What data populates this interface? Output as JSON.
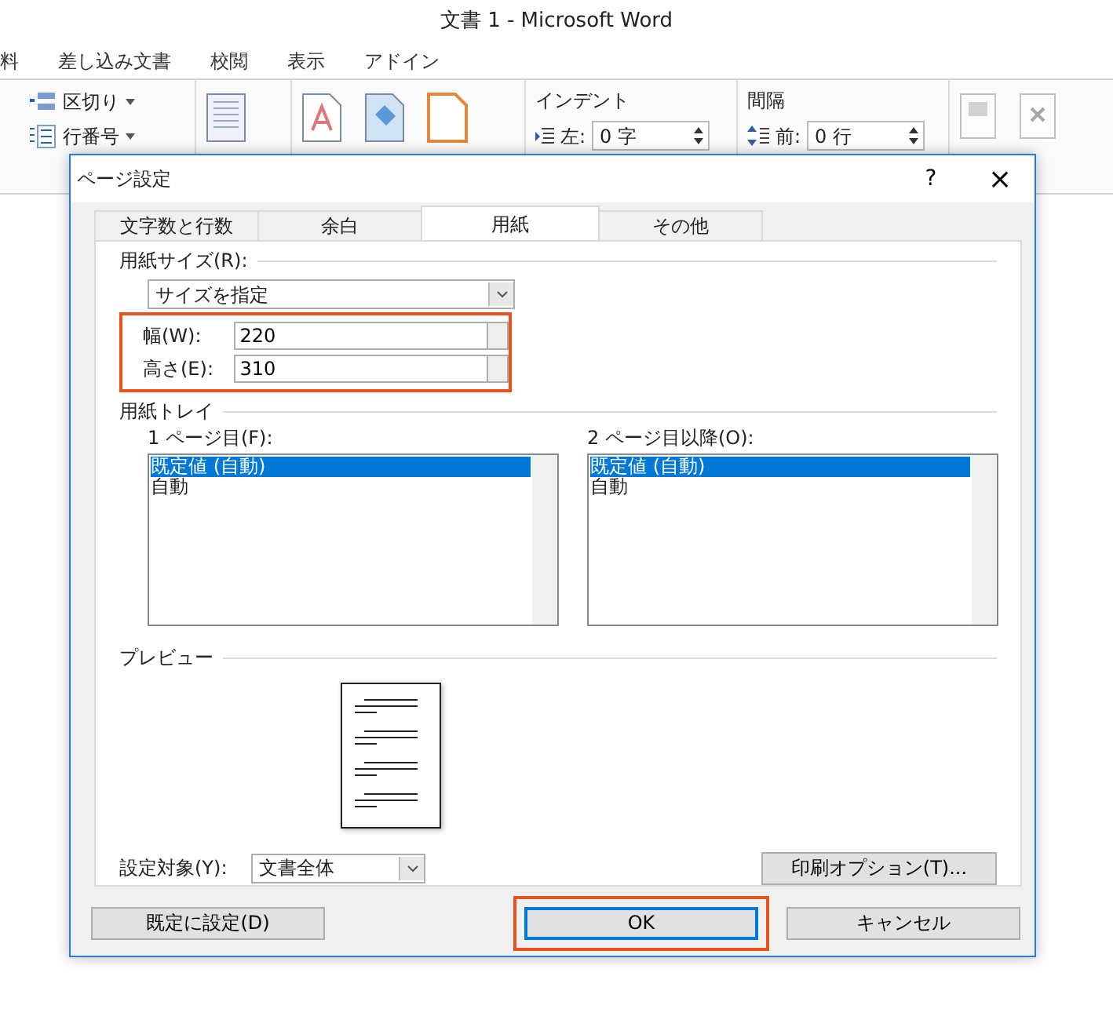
{
  "window": {
    "title": "文書 1 - Microsoft Word"
  },
  "ribbon_tabs": [
    {
      "label": "料"
    },
    {
      "label": "差し込み文書"
    },
    {
      "label": "校閲"
    },
    {
      "label": "表示"
    },
    {
      "label": "アドイン"
    }
  ],
  "ribbon": {
    "commands": [
      {
        "label": "区切り"
      },
      {
        "label": "行番号"
      }
    ],
    "indent": {
      "title": "インデント",
      "label": "左:",
      "value": "0 字"
    },
    "spacing": {
      "title": "間隔",
      "label": "前:",
      "value": "0 行"
    }
  },
  "dialog": {
    "title": "ページ設定",
    "help": "?",
    "close": "×",
    "tabs": [
      {
        "label": "文字数と行数",
        "selected": false
      },
      {
        "label": "余白",
        "selected": false
      },
      {
        "label": "用紙",
        "selected": true
      },
      {
        "label": "その他",
        "selected": false
      }
    ],
    "paper_size": {
      "heading": "用紙サイズ(R):",
      "size": "サイズを指定",
      "highlighted": true,
      "fields": [
        {
          "label": "幅(W):",
          "value": "220"
        },
        {
          "label": "高さ(E):",
          "value": "310"
        }
      ]
    },
    "paper_tray": {
      "heading": "用紙トレイ",
      "lists": [
        {
          "label": "1 ページ目(F):",
          "items": [
            {
              "text": "既定値 (自動)",
              "selected": true
            },
            {
              "text": "自動",
              "selected": false
            }
          ]
        },
        {
          "label": "2 ページ目以降(O):",
          "items": [
            {
              "text": "既定値 (自動)",
              "selected": true
            },
            {
              "text": "自動",
              "selected": false
            }
          ]
        }
      ]
    },
    "preview": {
      "heading": "プレビュー"
    },
    "apply_to": {
      "label": "設定対象(Y):",
      "value": "文書全体"
    },
    "print_options": "印刷オプション(T)...",
    "buttons": [
      {
        "label": "既定に設定(D)",
        "highlighted": false,
        "default": false
      },
      {
        "label": "OK",
        "highlighted": true,
        "default": true
      },
      {
        "label": "キャンセル",
        "highlighted": false,
        "default": false
      }
    ]
  }
}
